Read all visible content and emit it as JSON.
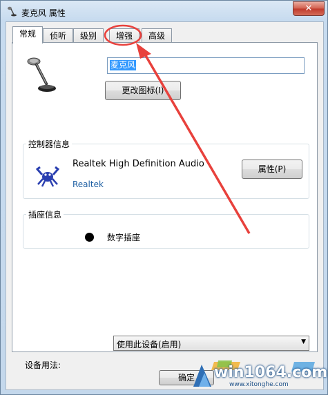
{
  "window": {
    "title": "麦克风 属性",
    "close_glyph": "✕"
  },
  "tabs": [
    {
      "label": "常规",
      "active": true
    },
    {
      "label": "侦听",
      "active": false
    },
    {
      "label": "级别",
      "active": false
    },
    {
      "label": "增强",
      "active": false,
      "annotated": true
    },
    {
      "label": "高级",
      "active": false
    }
  ],
  "general": {
    "device_name": "麦克风",
    "change_icon_button": "更改图标(I)",
    "controller": {
      "group_label": "控制器信息",
      "name": "Realtek High Definition Audio",
      "vendor_link": "Realtek",
      "properties_button": "属性(P)"
    },
    "jack": {
      "group_label": "插座信息",
      "type": "数字插座"
    },
    "usage": {
      "label": "设备用法:",
      "selected": "使用此设备(启用)"
    }
  },
  "footer": {
    "ok_button": "确定"
  },
  "annotation": {
    "color": "#e8413c"
  },
  "watermark": {
    "text": "win1064.com",
    "sub": "www.xitonghe.com"
  }
}
